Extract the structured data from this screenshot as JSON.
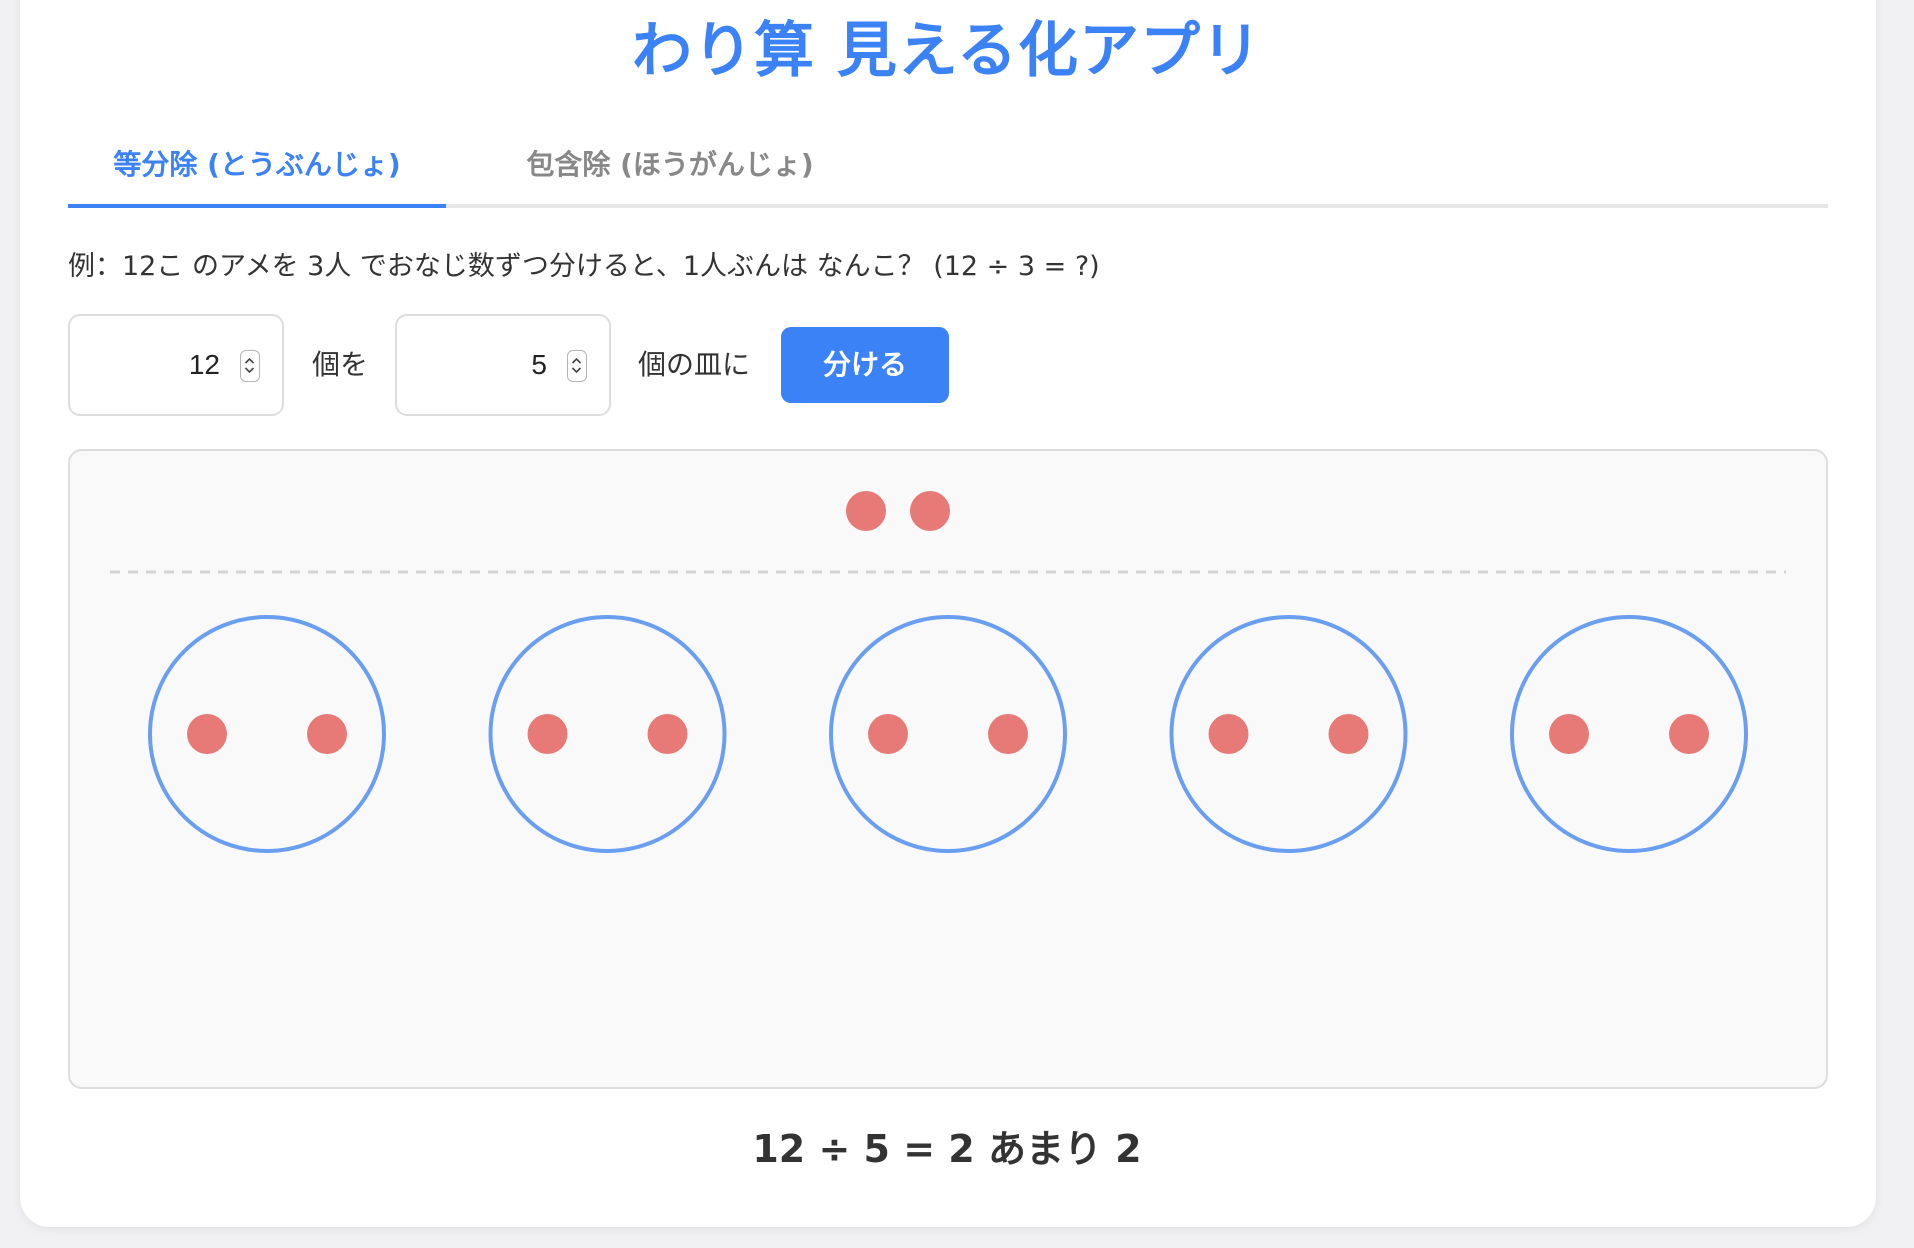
{
  "app": {
    "title": "わり算 見える化アプリ"
  },
  "tabs": [
    {
      "label": "等分除 (とうぶんじょ)",
      "active": true
    },
    {
      "label": "包含除 (ほうがんじょ)",
      "active": false
    }
  ],
  "example_text": "例：12こ のアメを 3人 でおなじ数ずつ分けると、1人ぶんは なんこ？ (12 ÷ 3 = ?)",
  "controls": {
    "total": "12",
    "label_after_total": "個を",
    "groups": "5",
    "label_after_groups": "個の皿に",
    "divide_button_label": "分ける"
  },
  "visualization": {
    "plates": 5,
    "items_per_plate": 2,
    "remainder_items": 2,
    "plate_color": "#6a9ef0",
    "item_color": "#e77a76",
    "divider_color": "#d5d5d5"
  },
  "result_text": "12 ÷ 5 = 2 あまり 2"
}
